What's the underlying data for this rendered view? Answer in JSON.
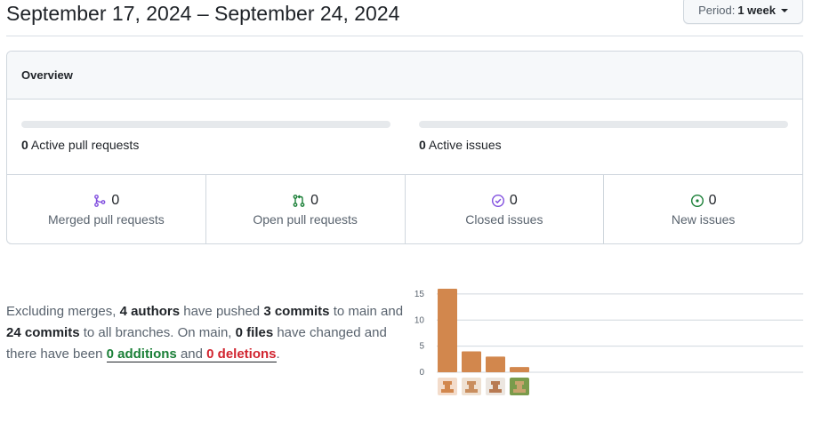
{
  "header": {
    "date_range": "September 17, 2024 – September 24, 2024",
    "period_label": "Period:",
    "period_value": "1 week"
  },
  "overview": {
    "title": "Overview",
    "active_prs": {
      "count": "0",
      "label": "Active pull requests",
      "fill": 0
    },
    "active_issues": {
      "count": "0",
      "label": "Active issues",
      "fill": 0
    },
    "stats": [
      {
        "count": "0",
        "label": "Merged pull requests",
        "icon": "git-merge-icon",
        "color": "#8250df"
      },
      {
        "count": "0",
        "label": "Open pull requests",
        "icon": "git-pull-request-icon",
        "color": "#1a7f37"
      },
      {
        "count": "0",
        "label": "Closed issues",
        "icon": "issue-closed-icon",
        "color": "#8250df"
      },
      {
        "count": "0",
        "label": "New issues",
        "icon": "issue-opened-icon",
        "color": "#1a7f37"
      }
    ]
  },
  "summary": {
    "p1": "Excluding merges, ",
    "authors": "4 authors",
    "p2": " have pushed ",
    "commits_main": "3 commits",
    "p3": " to main and ",
    "commits_all": "24 commits",
    "p4": " to all branches. On main, ",
    "files": "0 files",
    "p5": " have changed and there have been ",
    "additions": "0 additions",
    "p6": " and ",
    "deletions": "0 deletions",
    "p7": "."
  },
  "chart_data": {
    "type": "bar",
    "categories": [
      "author-1",
      "author-2",
      "author-3",
      "author-4"
    ],
    "values": [
      16,
      4,
      3,
      1
    ],
    "yticks": [
      0,
      5,
      10,
      15
    ],
    "ylim": [
      0,
      16
    ],
    "bar_color": "#d2874d",
    "grid": true
  }
}
